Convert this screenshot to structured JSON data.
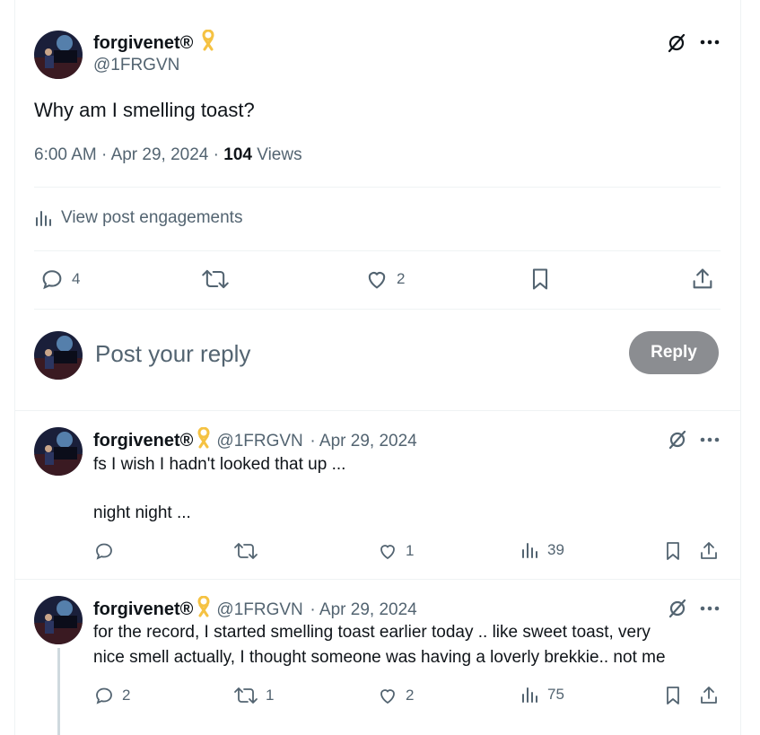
{
  "post": {
    "author_name": "forgivenet®",
    "author_handle": "@1FRGVN",
    "text": "Why am I smelling toast?",
    "time": "6:00 AM",
    "date": "Apr 29, 2024",
    "views_count": "104",
    "views_label": "Views",
    "engagements_label": "View post engagements",
    "replies": "4",
    "reposts": "",
    "likes": "2"
  },
  "composer": {
    "placeholder": "Post your reply",
    "button_label": "Reply"
  },
  "replies": [
    {
      "author_name": "forgivenet®",
      "author_handle": "@1FRGVN",
      "date": "· Apr 29, 2024",
      "line1": "fs I wish I hadn't looked that up ...",
      "line2": "night night ...",
      "replies": "",
      "reposts": "",
      "likes": "1",
      "views": "39"
    },
    {
      "author_name": "forgivenet®",
      "author_handle": "@1FRGVN",
      "date": "· Apr 29, 2024",
      "line1": "for the record, I started smelling toast earlier today .. like sweet toast, very",
      "line2": "nice smell actually, I thought someone was having a loverly brekkie.. not me",
      "replies": "2",
      "reposts": "1",
      "likes": "2",
      "views": "75"
    }
  ],
  "colors": {
    "text": "#0f1419",
    "secondary": "#536471",
    "reply_button": "#8b8d91",
    "ribbon": "#f5c242",
    "divider": "#eff3f4"
  }
}
